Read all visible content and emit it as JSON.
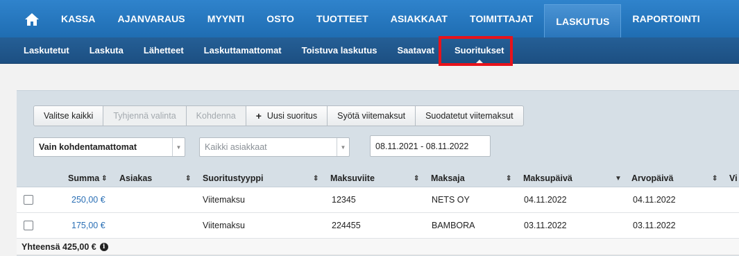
{
  "top_nav": {
    "items": [
      "KASSA",
      "AJANVARAUS",
      "MYYNTI",
      "OSTO",
      "TUOTTEET",
      "ASIAKKAAT",
      "TOIMITTAJAT",
      "LASKUTUS",
      "RAPORTOINTI"
    ],
    "active": "LASKUTUS"
  },
  "sub_nav": {
    "items": [
      "Laskutetut",
      "Laskuta",
      "Lähetteet",
      "Laskuttamattomat",
      "Toistuva laskutus",
      "Saatavat",
      "Suoritukset"
    ],
    "active": "Suoritukset"
  },
  "toolbar": {
    "select_all": "Valitse kaikki",
    "clear_selection": "Tyhjennä valinta",
    "allocate": "Kohdenna",
    "new_payment": "Uusi suoritus",
    "enter_reference_payments": "Syötä viitemaksut",
    "filtered_reference_payments": "Suodatetut viitemaksut"
  },
  "filters": {
    "allocation_filter": "Vain kohdentamattomat",
    "customer_filter": "Kaikki asiakkaat",
    "date_range": "08.11.2021 - 08.11.2022"
  },
  "table": {
    "columns": [
      "Summa",
      "Asiakas",
      "Suoritustyyppi",
      "Maksuviite",
      "Maksaja",
      "Maksupäivä",
      "Arvopäivä",
      "Vi"
    ],
    "rows": [
      {
        "summa": "250,00 €",
        "asiakas": "",
        "tyyppi": "Viitemaksu",
        "viite": "12345",
        "maksaja": "NETS OY",
        "maksupaiva": "04.11.2022",
        "arvopaiva": "04.11.2022"
      },
      {
        "summa": "175,00 €",
        "asiakas": "",
        "tyyppi": "Viitemaksu",
        "viite": "224455",
        "maksaja": "BAMBORA",
        "maksupaiva": "03.11.2022",
        "arvopaiva": "03.11.2022"
      }
    ],
    "total": "Yhteensä 425,00 €"
  },
  "colors": {
    "nav_blue": "#2f83cc",
    "subnav_blue": "#1c4f82",
    "highlight_red": "#e8131b",
    "link_blue": "#2a6fb5"
  }
}
